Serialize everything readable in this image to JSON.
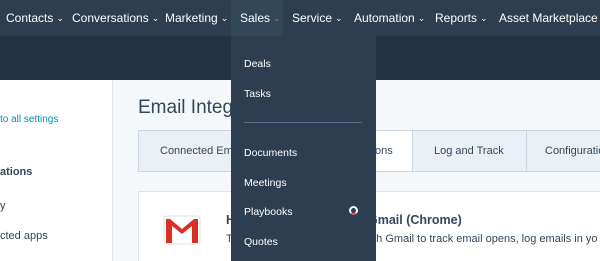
{
  "nav": {
    "items": [
      {
        "label": "Contacts"
      },
      {
        "label": "Conversations"
      },
      {
        "label": "Marketing"
      },
      {
        "label": "Sales"
      },
      {
        "label": "Service"
      },
      {
        "label": "Automation"
      },
      {
        "label": "Reports"
      },
      {
        "label": "Asset Marketplace"
      }
    ],
    "chevron": "⌄",
    "active": "Sales"
  },
  "sidebar": {
    "back_link": "to all settings",
    "section_heading": "ations",
    "items": [
      {
        "label": "y"
      },
      {
        "label": "cted apps"
      }
    ]
  },
  "main": {
    "title": "Email Integ",
    "tabs": [
      {
        "label": "Connected Em"
      },
      {
        "label": "ons"
      },
      {
        "label": "Log and Track"
      },
      {
        "label": "Configuratio"
      }
    ],
    "card": {
      "title_left": "H",
      "title_right": "or Gmail (Chrome)",
      "desc_left": "T",
      "desc_right": "with Gmail to track email opens, log emails in yo",
      "logo_icon": "gmail-icon"
    }
  },
  "dropdown": {
    "items": [
      {
        "label": "Deals"
      },
      {
        "label": "Tasks"
      },
      {
        "label": "Documents"
      },
      {
        "label": "Meetings"
      },
      {
        "label": "Playbooks"
      },
      {
        "label": "Quotes"
      }
    ],
    "loading_icon": "spinner-icon"
  },
  "colors": {
    "nav_bg": "#2d3e50",
    "band_bg": "#253342",
    "accent_red": "#f2545b",
    "link": "#0091ae"
  }
}
